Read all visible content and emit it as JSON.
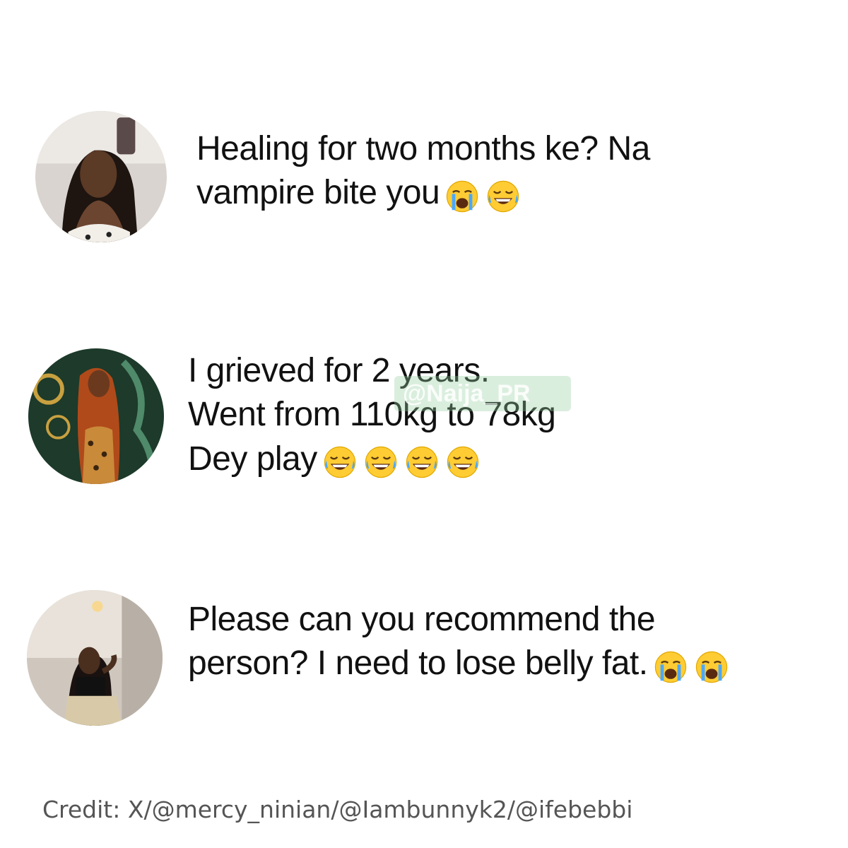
{
  "posts": [
    {
      "lines": [
        "Healing for two months ke? Na",
        "vampire bite you"
      ],
      "emojis": [
        "loudly-crying-face",
        "face-with-tears-of-joy"
      ]
    },
    {
      "lines": [
        "I grieved for 2 years.",
        "Went from 110kg to 78kg",
        "Dey play"
      ],
      "emojis": [
        "face-with-tears-of-joy",
        "face-with-tears-of-joy",
        "face-with-tears-of-joy",
        "face-with-tears-of-joy"
      ]
    },
    {
      "lines": [
        "Please can you recommend the",
        "person? I need to lose belly fat."
      ],
      "emojis": [
        "loudly-crying-face",
        "loudly-crying-face"
      ]
    }
  ],
  "watermark": "@Naija_PR",
  "credit": "Credit: X/@mercy_ninian/@Iambunnyk2/@ifebebbi"
}
